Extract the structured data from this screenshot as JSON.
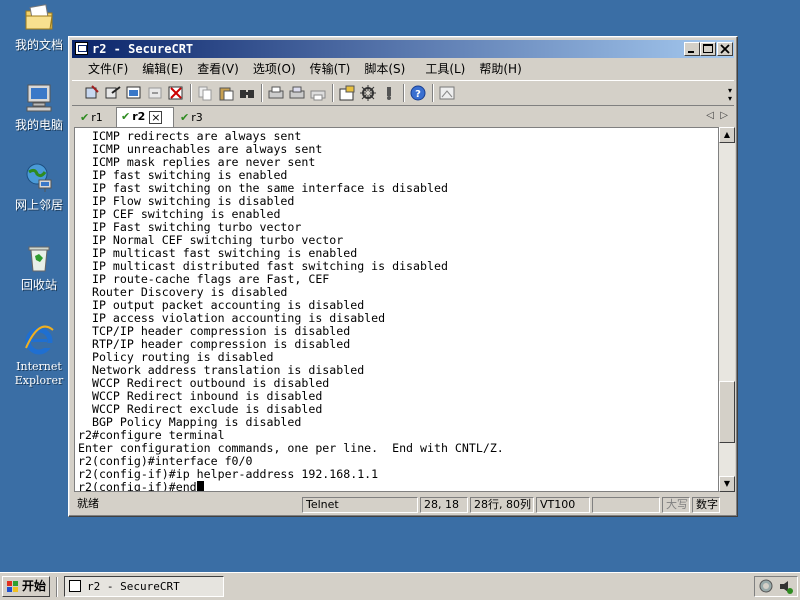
{
  "desktop": {
    "icons": [
      {
        "label": "我的文档",
        "icon": "my-documents-icon"
      },
      {
        "label": "我的电脑",
        "icon": "my-computer-icon"
      },
      {
        "label": "网上邻居",
        "icon": "network-places-icon"
      },
      {
        "label": "回收站",
        "icon": "recycle-bin-icon"
      },
      {
        "label1": "Internet",
        "label2": "Explorer",
        "icon": "internet-explorer-icon"
      }
    ]
  },
  "window": {
    "title": "r2 - SecureCRT",
    "menu": [
      "文件(F)",
      "编辑(E)",
      "查看(V)",
      "选项(O)",
      "传输(T)",
      "脚本(S)",
      "工具(L)",
      "帮助(H)"
    ],
    "tabs": [
      {
        "label": "r1",
        "active": false
      },
      {
        "label": "r2",
        "active": true
      },
      {
        "label": "r3",
        "active": false
      }
    ],
    "tab_close_glyph": "×",
    "terminal_lines": [
      "  ICMP redirects are always sent",
      "  ICMP unreachables are always sent",
      "  ICMP mask replies are never sent",
      "  IP fast switching is enabled",
      "  IP fast switching on the same interface is disabled",
      "  IP Flow switching is disabled",
      "  IP CEF switching is enabled",
      "  IP Fast switching turbo vector",
      "  IP Normal CEF switching turbo vector",
      "  IP multicast fast switching is enabled",
      "  IP multicast distributed fast switching is disabled",
      "  IP route-cache flags are Fast, CEF",
      "  Router Discovery is disabled",
      "  IP output packet accounting is disabled",
      "  IP access violation accounting is disabled",
      "  TCP/IP header compression is disabled",
      "  RTP/IP header compression is disabled",
      "  Policy routing is disabled",
      "  Network address translation is disabled",
      "  WCCP Redirect outbound is disabled",
      "  WCCP Redirect inbound is disabled",
      "  WCCP Redirect exclude is disabled",
      "  BGP Policy Mapping is disabled",
      "r2#configure terminal",
      "Enter configuration commands, one per line.  End with CNTL/Z.",
      "r2(config)#interface f0/0",
      "r2(config-if)#ip helper-address 192.168.1.1",
      "r2(config-if)#end"
    ],
    "status": {
      "ready": "就绪",
      "protocol": "Telnet",
      "cursor_pos": "28, 18",
      "rows_cols": "28行, 80列",
      "emulation": "VT100",
      "caps": "大写",
      "num": "数字"
    },
    "scroll_position": 0.88
  },
  "taskbar": {
    "start_label": "开始",
    "task_label": "r2 - SecureCRT"
  },
  "colors": {
    "desktop": "#3a6ea5",
    "title_active_start": "#0a246a",
    "title_active_end": "#a6caf0",
    "check_green": "#2e8b20"
  }
}
